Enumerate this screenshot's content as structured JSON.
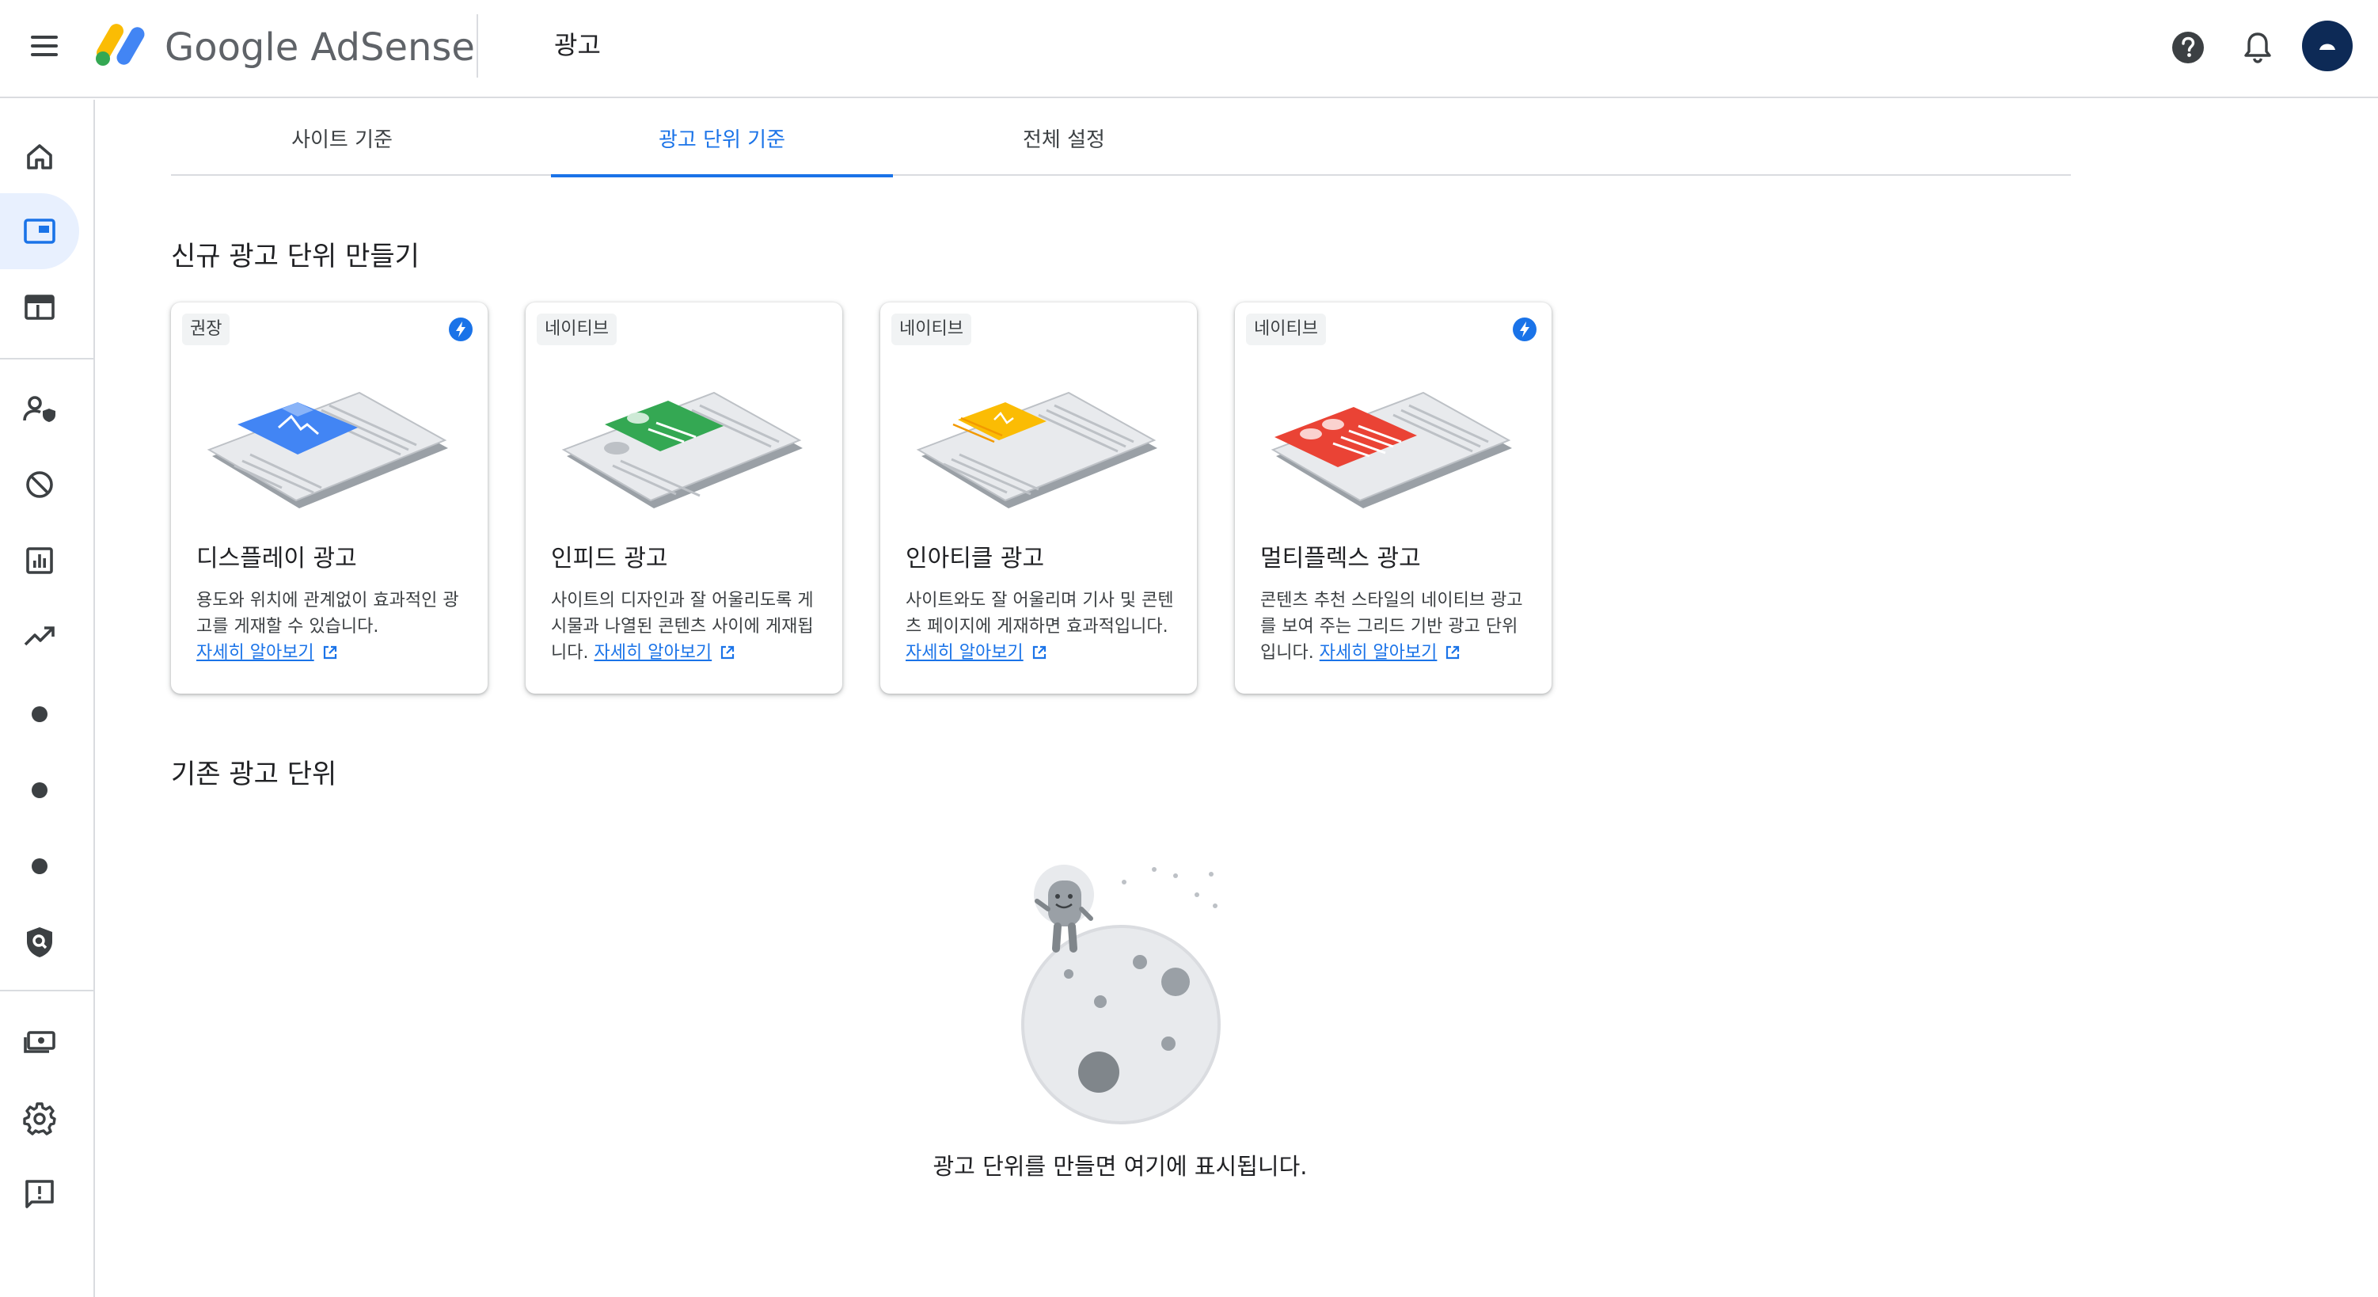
{
  "header": {
    "brand": "Google AdSense",
    "page_title": "광고"
  },
  "tabs": [
    {
      "label": "사이트 기준",
      "active": false
    },
    {
      "label": "광고 단위 기준",
      "active": true
    },
    {
      "label": "전체 설정",
      "active": false
    }
  ],
  "sidebar": {
    "items": [
      {
        "icon": "home-icon"
      },
      {
        "icon": "ads-icon",
        "active": true
      },
      {
        "icon": "sites-icon"
      },
      {
        "icon": "privacy-messaging-icon"
      },
      {
        "icon": "blocking-controls-icon"
      },
      {
        "icon": "reports-icon"
      },
      {
        "icon": "optimization-icon"
      },
      {
        "icon": "dot-icon"
      },
      {
        "icon": "dot-icon"
      },
      {
        "icon": "dot-icon"
      },
      {
        "icon": "policy-center-icon"
      },
      {
        "icon": "payments-icon"
      },
      {
        "icon": "settings-icon"
      },
      {
        "icon": "feedback-icon"
      }
    ]
  },
  "new_section": {
    "title": "신규 광고 단위 만들기",
    "cards": [
      {
        "badge": "권장",
        "has_bolt": true,
        "title": "디스플레이 광고",
        "desc": "용도와 위치에 관계없이 효과적인 광고를 게재할 수 있습니다.",
        "link": "자세히 알아보기",
        "color": "#4285f4"
      },
      {
        "badge": "네이티브",
        "has_bolt": false,
        "title": "인피드 광고",
        "desc": "사이트의 디자인과 잘 어울리도록 게시물과 나열된 콘텐츠 사이에 게재됩니다.",
        "link": "자세히 알아보기",
        "color": "#34a853"
      },
      {
        "badge": "네이티브",
        "has_bolt": false,
        "title": "인아티클 광고",
        "desc": "사이트와도 잘 어울리며 기사 및 콘텐츠 페이지에 게재하면 효과적입니다.",
        "link": "자세히 알아보기",
        "color": "#fbbc04"
      },
      {
        "badge": "네이티브",
        "has_bolt": true,
        "title": "멀티플렉스 광고",
        "desc": "콘텐츠 추천 스타일의 네이티브 광고를 보여 주는 그리드 기반 광고 단위입니다.",
        "link": "자세히 알아보기",
        "color": "#ea4335"
      }
    ]
  },
  "existing_section": {
    "title": "기존 광고 단위",
    "empty_text": "광고 단위를 만들면 여기에 표시됩니다."
  }
}
